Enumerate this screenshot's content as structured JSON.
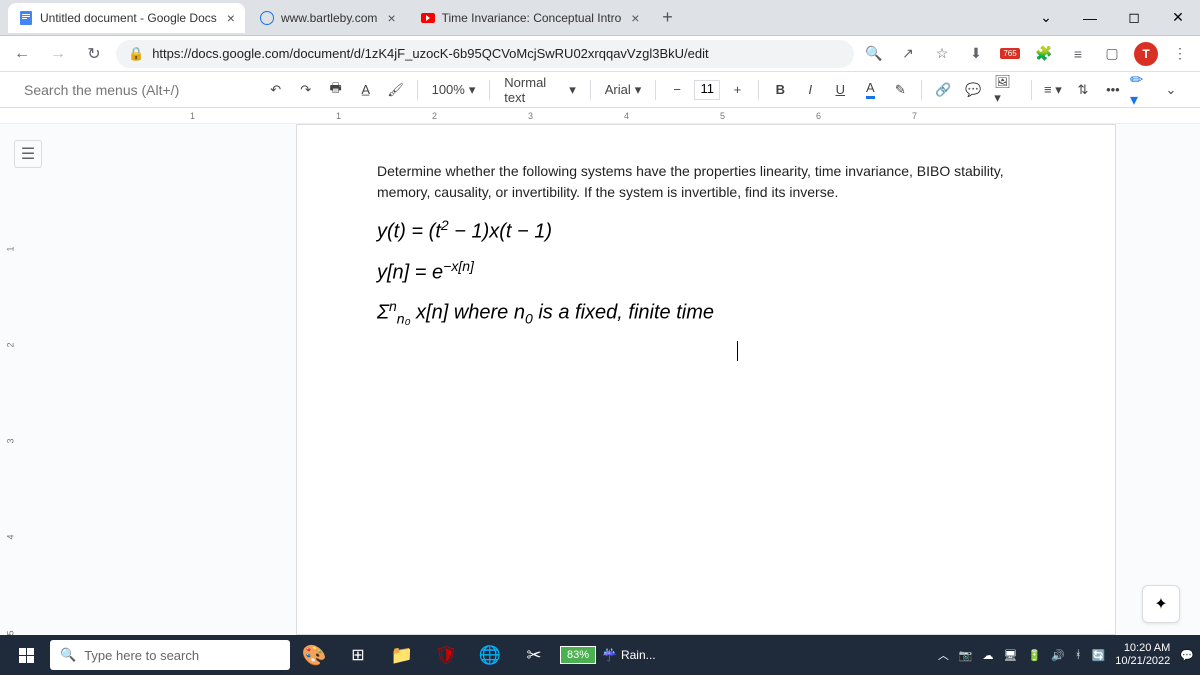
{
  "tabs": [
    {
      "title": "Untitled document - Google Docs",
      "icon": "docs"
    },
    {
      "title": "www.bartleby.com",
      "icon": "globe"
    },
    {
      "title": "Time Invariance: Conceptual Intro",
      "icon": "youtube"
    }
  ],
  "url": "https://docs.google.com/document/d/1zK4jF_uzocK-6b95QCVoMcjSwRU02xrqqavVzgl3BkU/edit",
  "ext_badge": "765",
  "profile_letter": "T",
  "toolbar": {
    "search_placeholder": "Search the menus (Alt+/)",
    "zoom": "100%",
    "style": "Normal text",
    "font": "Arial",
    "font_size": "11",
    "bold": "B",
    "italic": "I",
    "underline": "U",
    "text_color": "A",
    "more": "•••"
  },
  "ruler_marks": [
    "1",
    "1",
    "2",
    "3",
    "4",
    "5",
    "6",
    "7"
  ],
  "v_ruler_marks": [
    "1",
    "2",
    "3",
    "4",
    "5"
  ],
  "document": {
    "intro": "Determine whether the following systems have the properties linearity, time invariance, BIBO stability, memory, causality, or invertibility. If the system is invertible, find its inverse.",
    "eq1_a": "y(t) = (t",
    "eq1_b": " − 1)x(t − 1)",
    "eq2_a": "y[n] = e",
    "eq2_exp": "−x[n]",
    "eq3_a": "Σ",
    "eq3_sub": "n₀",
    "eq3_sup": "n",
    "eq3_b": " x[n] where n",
    "eq3_sub2": "0",
    "eq3_c": " is a fixed, finite time"
  },
  "taskbar": {
    "search_placeholder": "Type here to search",
    "battery": "83%",
    "weather": "Rain...",
    "time": "10:20 AM",
    "date": "10/21/2022"
  }
}
